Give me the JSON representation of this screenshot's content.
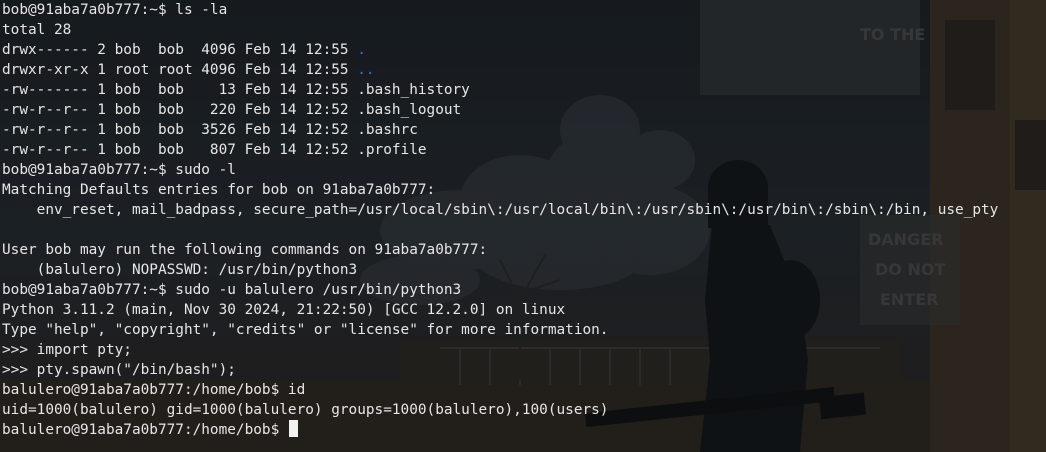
{
  "window": {
    "title": ""
  },
  "background": {
    "description": "dim anime scene wallpaper behind terminal text",
    "sign_text": [
      "DANGER",
      "DO NOT",
      "ENTER"
    ],
    "signboard_top": "TO THE"
  },
  "terminal": {
    "lines": [
      {
        "text": "bob@91aba7a0b777:~$ ls -la"
      },
      {
        "text": "total 28"
      },
      {
        "text": "drwx------ 2 bob  bob  4096 Feb 14 12:55 ",
        "suffix": "."
      },
      {
        "text": "drwxr-xr-x 1 root root 4096 Feb 14 12:55 ",
        "suffix": ".."
      },
      {
        "text": "-rw------- 1 bob  bob    13 Feb 14 12:55 .bash_history"
      },
      {
        "text": "-rw-r--r-- 1 bob  bob   220 Feb 14 12:52 .bash_logout"
      },
      {
        "text": "-rw-r--r-- 1 bob  bob  3526 Feb 14 12:52 .bashrc"
      },
      {
        "text": "-rw-r--r-- 1 bob  bob   807 Feb 14 12:52 .profile"
      },
      {
        "text": "bob@91aba7a0b777:~$ sudo -l"
      },
      {
        "text": "Matching Defaults entries for bob on 91aba7a0b777:"
      },
      {
        "text": "    env_reset, mail_badpass, secure_path=/usr/local/sbin\\:/usr/local/bin\\:/usr/sbin\\:/usr/bin\\:/sbin\\:/bin, use_pty"
      },
      {
        "text": ""
      },
      {
        "text": "User bob may run the following commands on 91aba7a0b777:"
      },
      {
        "text": "    (balulero) NOPASSWD: /usr/bin/python3"
      },
      {
        "text": "bob@91aba7a0b777:~$ sudo -u balulero /usr/bin/python3"
      },
      {
        "text": "Python 3.11.2 (main, Nov 30 2024, 21:22:50) [GCC 12.2.0] on linux"
      },
      {
        "text": "Type \"help\", \"copyright\", \"credits\" or \"license\" for more information."
      },
      {
        "text": ">>> import pty;"
      },
      {
        "text": ">>> pty.spawn(\"/bin/bash\");"
      },
      {
        "text": "balulero@91aba7a0b777:/home/bob$ id"
      },
      {
        "text": "uid=1000(balulero) gid=1000(balulero) groups=1000(balulero),100(users)"
      },
      {
        "text": "balulero@91aba7a0b777:/home/bob$ "
      }
    ]
  },
  "colors": {
    "text": "#e6e6e6",
    "dir_highlight": "#3b6ed6",
    "cursor": "#f2f2f2"
  }
}
